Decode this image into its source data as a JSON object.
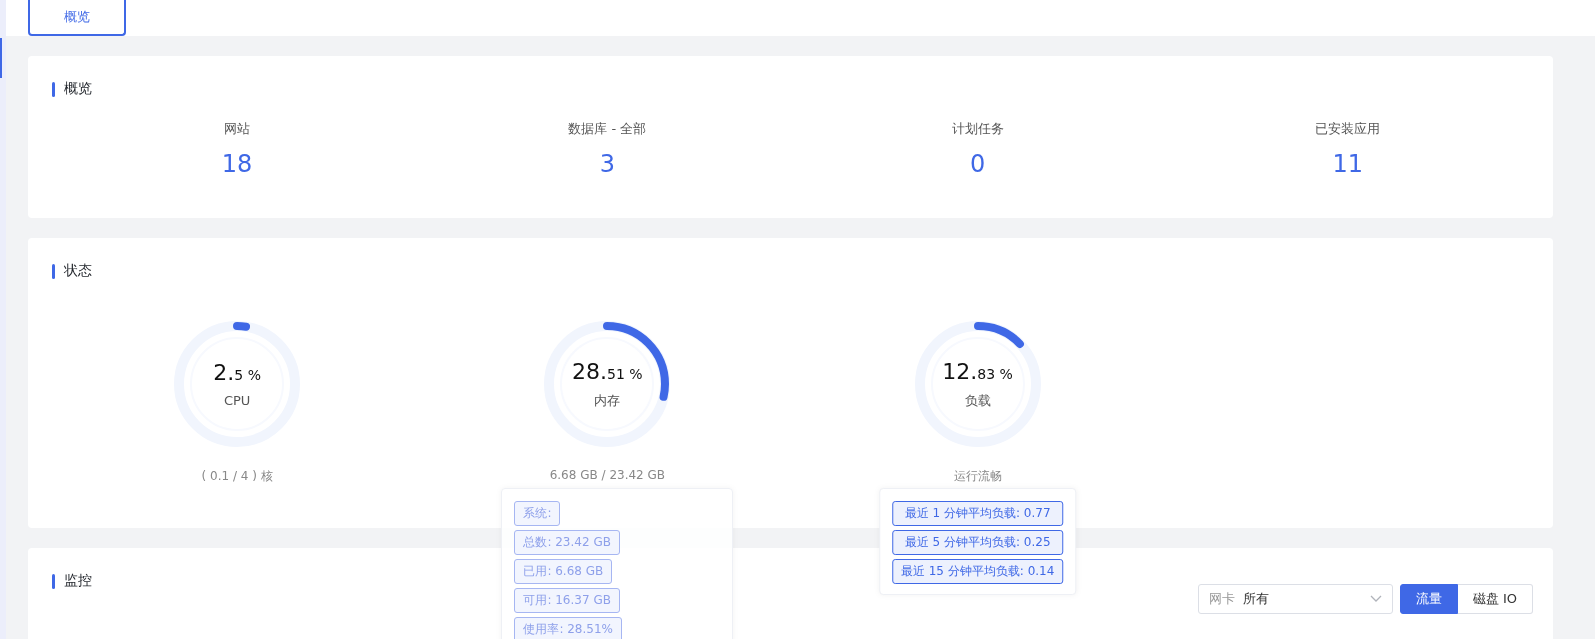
{
  "tabs": [
    {
      "label": "概览",
      "selected": true
    }
  ],
  "overview": {
    "title": "概览",
    "stats": [
      {
        "label": "网站",
        "value": "18"
      },
      {
        "label": "数据库 - 全部",
        "value": "3"
      },
      {
        "label": "计划任务",
        "value": "0"
      },
      {
        "label": "已安装应用",
        "value": "11"
      }
    ]
  },
  "status": {
    "title": "状态",
    "gauges": [
      {
        "whole": "2.",
        "fraction": "5 %",
        "label": "CPU",
        "level": 0.025,
        "detail": "( 0.1 / 4 ) 核"
      },
      {
        "whole": "28.",
        "fraction": "51 %",
        "label": "内存",
        "level": 0.2851,
        "detail": "6.68 GB / 23.42 GB",
        "tooltip": {
          "faded": true,
          "items": [
            "系统:",
            "总数: 23.42 GB",
            "已用: 6.68 GB",
            "可用: 16.37 GB",
            "使用率: 28.51%"
          ]
        }
      },
      {
        "whole": "12.",
        "fraction": "83 %",
        "label": "负载",
        "level": 0.1283,
        "detail": "运行流畅",
        "tooltip": {
          "faded": false,
          "items": [
            "最近 1 分钟平均负载: 0.77",
            "最近 5 分钟平均负载: 0.25",
            "最近 15 分钟平均负载: 0.14"
          ]
        }
      }
    ]
  },
  "monitor": {
    "title": "监控",
    "select": {
      "label": "网卡",
      "value": "所有"
    },
    "modes": [
      {
        "label": "流量",
        "selected": true
      },
      {
        "label": "磁盘 IO",
        "selected": false
      }
    ]
  }
}
